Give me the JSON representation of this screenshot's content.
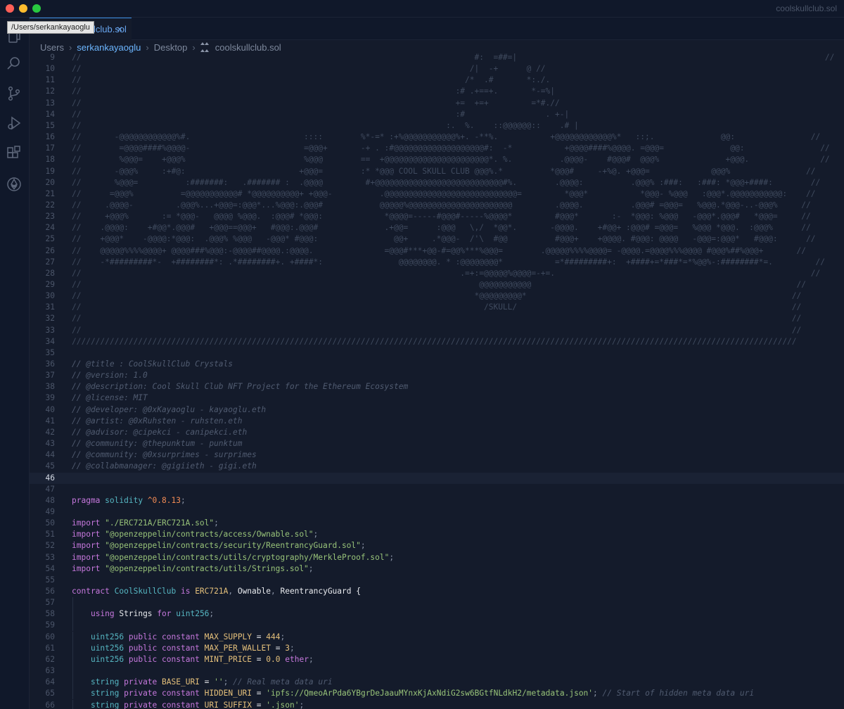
{
  "window": {
    "title": "coolskullclub.sol"
  },
  "tab": {
    "label": "coolskullclub.sol",
    "close": "×",
    "tooltip": "/Users/serkankayaoglu"
  },
  "breadcrumb": [
    "Users",
    "serkankayaoglu",
    "Desktop",
    "coolskullclub.sol"
  ],
  "activity_icons": [
    "explorer-icon",
    "search-icon",
    "source-control-icon",
    "run-debug-icon",
    "extensions-icon",
    "ethereum-icon"
  ],
  "colors": {
    "background": "#141b2b",
    "accent": "#3a8ee6",
    "keyword": "#c678dd",
    "string": "#98c379",
    "number": "#f28b54"
  },
  "current_line": 46,
  "lines": [
    {
      "n": 9,
      "s": [
        [
          "art",
          "//                                                                                   #:  =##=|                                                                 //"
        ]
      ]
    },
    {
      "n": 10,
      "s": [
        [
          "art",
          "//                                                                                  /|  -+      @ //                                                               //"
        ]
      ]
    },
    {
      "n": 11,
      "s": [
        [
          "art",
          "//                                                                                 /*  .#       *:./.                                                              //"
        ]
      ]
    },
    {
      "n": 12,
      "s": [
        [
          "art",
          "//                                                                               :# .+==+.       *-=%|                                                             //"
        ]
      ]
    },
    {
      "n": 13,
      "s": [
        [
          "art",
          "//                                                                               +=  +=+         =*#.//                                                            //"
        ]
      ]
    },
    {
      "n": 14,
      "s": [
        [
          "art",
          "//                                                                               :#                 . +-|                                                          //"
        ]
      ]
    },
    {
      "n": 15,
      "s": [
        [
          "art",
          "//                                                                             :.  %.    ::@@@@@@::    .# |                                                        //"
        ]
      ]
    },
    {
      "n": 16,
      "s": [
        [
          "art",
          "//       -@@@@@@@@@@@@%#.                        ::::        %*-=* :+%@@@@@@@@@@@%+. -**%.           +@@@@@@@@@@@@%*   ::;.              @@:                //"
        ]
      ]
    },
    {
      "n": 17,
      "s": [
        [
          "art",
          "//        =@@@@####%@@@@-                        =@@@+       -+ . :#@@@@@@@@@@@@@@@@@@@#:  -*           +@@@@####%@@@@. =@@@=              @@:                //"
        ]
      ]
    },
    {
      "n": 18,
      "s": [
        [
          "art",
          "//        %@@@=    +@@@%                         %@@@        ==  +@@@@@@@@@@@@@@@@@@@@@@*. %.          .@@@@-    #@@@#  @@@%              +@@@.               //"
        ]
      ]
    },
    {
      "n": 19,
      "s": [
        [
          "art",
          "//       -@@@%     :+#@:                        +@@@=        :* *@@@ COOL SKULL CLUB @@@%.*          *@@@#     -+%@. +@@@=             @@@%                //"
        ]
      ]
    },
    {
      "n": 20,
      "s": [
        [
          "art",
          "//       %@@@=          :#######:   .####### :  .@@@@         #+@@@@@@@@@@@@@@@@@@@@@@@@@@@#%.        .@@@@:          .@@@% :###:   :###: *@@@+####:        //"
        ]
      ]
    },
    {
      "n": 21,
      "s": [
        [
          "art",
          "//      =@@@%          =@@@@@@@@@@@# *@@@@@@@@@@+ +@@@-          .@@@@@@@@@@@@@@@@@@@@@@@@@@@@=         *@@@*           *@@@- %@@@   :@@@*.@@@@@@@@@@@:    //"
        ]
      ]
    },
    {
      "n": 22,
      "s": [
        [
          "art",
          "//     .@@@@-         .@@@%...+@@@=:@@@*...%@@@:.@@@#            @@@@@%@@@@@@@@@@@@@@@@@@@@@@         .@@@@.          .@@@# =@@@=   %@@@.*@@@-..-@@@%     //"
        ]
      ]
    },
    {
      "n": 23,
      "s": [
        [
          "art",
          "//     +@@@%       := *@@@-   @@@@ %@@@.  :@@@# *@@@:             *@@@@=-----#@@@#-----%@@@@*         #@@@*       :-  *@@@: %@@@   -@@@*.@@@#   *@@@=     //"
        ]
      ]
    },
    {
      "n": 24,
      "s": [
        [
          "art",
          "//    .@@@@:    +#@@*.@@@#   +@@@==@@@+   #@@@:.@@@#              .+@@=      :@@@   \\,/  *@@*.       -@@@@.    +#@@+ :@@@# =@@@=   %@@@ *@@@.  :@@@%      //"
        ]
      ]
    },
    {
      "n": 25,
      "s": [
        [
          "art",
          "//    +@@@*    -@@@@:*@@@:  .@@@% %@@@   -@@@* #@@@:                @@+     .*@@@-  /'\\  #@@          #@@@+    +@@@@. #@@@: @@@@   -@@@=:@@@*   #@@@:      //"
        ]
      ]
    },
    {
      "n": 26,
      "s": [
        [
          "art",
          "//    @@@@@%%%%@@@@+ @@@@###%@@@:-@@@@##@@@@.:@@@@.               =@@@#***+@@-#=@@%***%@@@=        .@@@@@%%%%@@@@= -@@@@.=@@@@%%%@@@@ #@@@%##%@@@+       //"
        ]
      ]
    },
    {
      "n": 27,
      "s": [
        [
          "art",
          "//    -*#########*-  +########*: .*########+. +####*:                @@@@@@@@. * :@@@@@@@@*           =*#########+:  +####+=*###*=*%@@%-:########*=.         //"
        ]
      ]
    },
    {
      "n": 28,
      "s": [
        [
          "art",
          "//                                                                                .=+:=@@@@@%@@@@=-+=.                                                      //"
        ]
      ]
    },
    {
      "n": 29,
      "s": [
        [
          "art",
          "//                                                                                    @@@@@@@@@@@                                                        //"
        ]
      ]
    },
    {
      "n": 30,
      "s": [
        [
          "art",
          "//                                                                                   *@@@@@@@@@*                                                        //"
        ]
      ]
    },
    {
      "n": 31,
      "s": [
        [
          "art",
          "//                                                                                     /SKULL/                                                          //"
        ]
      ]
    },
    {
      "n": 32,
      "s": [
        [
          "art",
          "//                                                                                                                                                      //"
        ]
      ]
    },
    {
      "n": 33,
      "s": [
        [
          "art",
          "//                                                                                                                                                      //"
        ]
      ]
    },
    {
      "n": 34,
      "s": [
        [
          "art",
          "/////////////////////////////////////////////////////////////////////////////////////////////////////////////////////////////////////////////////////////"
        ]
      ]
    },
    {
      "n": 35,
      "s": []
    },
    {
      "n": 36,
      "s": [
        [
          "cm",
          "// @title : CoolSkullClub Crystals"
        ]
      ]
    },
    {
      "n": 37,
      "s": [
        [
          "cm",
          "// @version: 1.0"
        ]
      ]
    },
    {
      "n": 38,
      "s": [
        [
          "cm",
          "// @description: Cool Skull Club NFT Project for the Ethereum Ecosystem"
        ]
      ]
    },
    {
      "n": 39,
      "s": [
        [
          "cm",
          "// @license: MIT"
        ]
      ]
    },
    {
      "n": 40,
      "s": [
        [
          "cm",
          "// @developer: @0xKayaoglu - kayaoglu.eth"
        ]
      ]
    },
    {
      "n": 41,
      "s": [
        [
          "cm",
          "// @artist: @0xRuhsten - ruhsten.eth"
        ]
      ]
    },
    {
      "n": 42,
      "s": [
        [
          "cm",
          "// @advisor: @cipekci - canipekci.eth"
        ]
      ]
    },
    {
      "n": 43,
      "s": [
        [
          "cm",
          "// @community: @thepunktum - punktum"
        ]
      ]
    },
    {
      "n": 44,
      "s": [
        [
          "cm",
          "// @community: @0xsurprimes - surprimes"
        ]
      ]
    },
    {
      "n": 45,
      "s": [
        [
          "cm",
          "// @collabmanager: @gigiieth - gigi.eth"
        ]
      ]
    },
    {
      "n": 46,
      "s": []
    },
    {
      "n": 47,
      "s": []
    },
    {
      "n": 48,
      "s": [
        [
          "kw",
          "pragma"
        ],
        [
          "pun",
          " "
        ],
        [
          "ty",
          "solidity"
        ],
        [
          "pun",
          " "
        ],
        [
          "num",
          "^0.8.13"
        ],
        [
          "pun",
          ";"
        ]
      ]
    },
    {
      "n": 49,
      "s": []
    },
    {
      "n": 50,
      "s": [
        [
          "kw",
          "import"
        ],
        [
          "pun",
          " "
        ],
        [
          "str",
          "\"./ERC721A/ERC721A.sol\""
        ],
        [
          "pun",
          ";"
        ]
      ]
    },
    {
      "n": 51,
      "s": [
        [
          "kw",
          "import"
        ],
        [
          "pun",
          " "
        ],
        [
          "str",
          "\"@openzeppelin/contracts/access/Ownable.sol\""
        ],
        [
          "pun",
          ";"
        ]
      ]
    },
    {
      "n": 52,
      "s": [
        [
          "kw",
          "import"
        ],
        [
          "pun",
          " "
        ],
        [
          "str",
          "\"@openzeppelin/contracts/security/ReentrancyGuard.sol\""
        ],
        [
          "pun",
          ";"
        ]
      ]
    },
    {
      "n": 53,
      "s": [
        [
          "kw",
          "import"
        ],
        [
          "pun",
          " "
        ],
        [
          "str",
          "\"@openzeppelin/contracts/utils/cryptography/MerkleProof.sol\""
        ],
        [
          "pun",
          ";"
        ]
      ]
    },
    {
      "n": 54,
      "s": [
        [
          "kw",
          "import"
        ],
        [
          "pun",
          " "
        ],
        [
          "str",
          "\"@openzeppelin/contracts/utils/Strings.sol\""
        ],
        [
          "pun",
          ";"
        ]
      ]
    },
    {
      "n": 55,
      "s": []
    },
    {
      "n": 56,
      "s": [
        [
          "kw",
          "contract"
        ],
        [
          "pun",
          " "
        ],
        [
          "ty",
          "CoolSkullClub"
        ],
        [
          "pun",
          " "
        ],
        [
          "kw",
          "is"
        ],
        [
          "pun",
          " "
        ],
        [
          "cls",
          "ERC721A"
        ],
        [
          "pun",
          ", "
        ],
        [
          "id",
          "Ownable"
        ],
        [
          "pun",
          ", "
        ],
        [
          "id",
          "ReentrancyGuard"
        ],
        [
          "pun",
          " "
        ],
        [
          "id",
          "{"
        ]
      ]
    },
    {
      "n": 57,
      "s": []
    },
    {
      "n": 58,
      "s": [
        [
          "pun",
          "    "
        ],
        [
          "kw",
          "using"
        ],
        [
          "pun",
          " "
        ],
        [
          "id",
          "Strings"
        ],
        [
          "pun",
          " "
        ],
        [
          "kw",
          "for"
        ],
        [
          "pun",
          " "
        ],
        [
          "ty",
          "uint256"
        ],
        [
          "pun",
          ";"
        ]
      ]
    },
    {
      "n": 59,
      "s": []
    },
    {
      "n": 60,
      "s": [
        [
          "pun",
          "    "
        ],
        [
          "ty",
          "uint256"
        ],
        [
          "pun",
          " "
        ],
        [
          "kw",
          "public"
        ],
        [
          "pun",
          " "
        ],
        [
          "kw",
          "constant"
        ],
        [
          "pun",
          " "
        ],
        [
          "cls",
          "MAX_SUPPLY"
        ],
        [
          "pun",
          " "
        ],
        [
          "id",
          "="
        ],
        [
          "pun",
          " "
        ],
        [
          "cls",
          "444"
        ],
        [
          "pun",
          ";"
        ]
      ]
    },
    {
      "n": 61,
      "s": [
        [
          "pun",
          "    "
        ],
        [
          "ty",
          "uint256"
        ],
        [
          "pun",
          " "
        ],
        [
          "kw",
          "public"
        ],
        [
          "pun",
          " "
        ],
        [
          "kw",
          "constant"
        ],
        [
          "pun",
          " "
        ],
        [
          "cls",
          "MAX_PER_WALLET"
        ],
        [
          "pun",
          " "
        ],
        [
          "id",
          "="
        ],
        [
          "pun",
          " "
        ],
        [
          "cls",
          "3"
        ],
        [
          "pun",
          ";"
        ]
      ]
    },
    {
      "n": 62,
      "s": [
        [
          "pun",
          "    "
        ],
        [
          "ty",
          "uint256"
        ],
        [
          "pun",
          " "
        ],
        [
          "kw",
          "public"
        ],
        [
          "pun",
          " "
        ],
        [
          "kw",
          "constant"
        ],
        [
          "pun",
          " "
        ],
        [
          "cls",
          "MINT_PRICE"
        ],
        [
          "pun",
          " "
        ],
        [
          "id",
          "="
        ],
        [
          "pun",
          " "
        ],
        [
          "cls",
          "0.0"
        ],
        [
          "pun",
          " "
        ],
        [
          "kw",
          "ether"
        ],
        [
          "pun",
          ";"
        ]
      ]
    },
    {
      "n": 63,
      "s": []
    },
    {
      "n": 64,
      "s": [
        [
          "pun",
          "    "
        ],
        [
          "ty",
          "string"
        ],
        [
          "pun",
          " "
        ],
        [
          "kw",
          "private"
        ],
        [
          "pun",
          " "
        ],
        [
          "cls",
          "BASE_URI"
        ],
        [
          "pun",
          " "
        ],
        [
          "id",
          "="
        ],
        [
          "pun",
          " "
        ],
        [
          "str",
          "''"
        ],
        [
          "pun",
          "; "
        ],
        [
          "cm",
          "// Real meta data uri"
        ]
      ]
    },
    {
      "n": 65,
      "s": [
        [
          "pun",
          "    "
        ],
        [
          "ty",
          "string"
        ],
        [
          "pun",
          " "
        ],
        [
          "kw",
          "private"
        ],
        [
          "pun",
          " "
        ],
        [
          "kw",
          "constant"
        ],
        [
          "pun",
          " "
        ],
        [
          "cls",
          "HIDDEN_URI"
        ],
        [
          "pun",
          " "
        ],
        [
          "id",
          "="
        ],
        [
          "pun",
          " "
        ],
        [
          "str",
          "'ipfs://QmeoArPda6YBgrDeJaauMYnxKjAxNdiG2sw6BGtfNLdkH2/metadata.json'"
        ],
        [
          "pun",
          "; "
        ],
        [
          "cm",
          "// Start of hidden meta data uri"
        ]
      ]
    },
    {
      "n": 66,
      "s": [
        [
          "pun",
          "    "
        ],
        [
          "ty",
          "string"
        ],
        [
          "pun",
          " "
        ],
        [
          "kw",
          "private"
        ],
        [
          "pun",
          " "
        ],
        [
          "kw",
          "constant"
        ],
        [
          "pun",
          " "
        ],
        [
          "cls",
          "URI_SUFFIX"
        ],
        [
          "pun",
          " "
        ],
        [
          "id",
          "="
        ],
        [
          "pun",
          " "
        ],
        [
          "str",
          "'.json'"
        ],
        [
          "pun",
          ";"
        ]
      ]
    }
  ]
}
